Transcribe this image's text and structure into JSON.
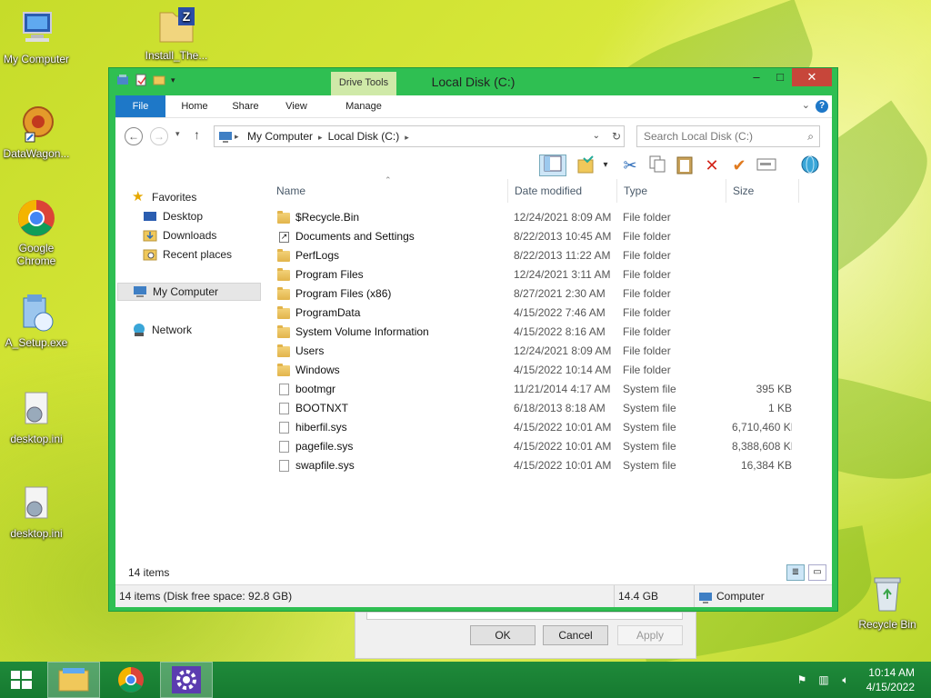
{
  "desktop": {
    "icons": [
      {
        "label": "My Computer"
      },
      {
        "label": "Install_The..."
      },
      {
        "label": "DataWagon..."
      },
      {
        "label": "Google Chrome"
      },
      {
        "label": "A_Setup.exe"
      },
      {
        "label": "desktop.ini"
      },
      {
        "label": "desktop.ini"
      },
      {
        "label": "Recycle Bin"
      }
    ]
  },
  "window": {
    "title": "Local Disk (C:)",
    "context_tab_header": "Drive Tools",
    "tabs": [
      "File",
      "Home",
      "Share",
      "View",
      "Manage"
    ],
    "help_label": "?",
    "address": {
      "crumbs": [
        "My Computer",
        "Local Disk (C:)"
      ]
    },
    "search_placeholder": "Search Local Disk (C:)",
    "navigation": {
      "favorites": "Favorites",
      "favorite_items": [
        "Desktop",
        "Downloads",
        "Recent places"
      ],
      "computer": "My Computer",
      "network": "Network"
    },
    "columns": [
      "Name",
      "Date modified",
      "Type",
      "Size"
    ],
    "files": [
      {
        "name": "$Recycle.Bin",
        "date": "12/24/2021 8:09 AM",
        "type": "File folder",
        "size": "",
        "icon": "folder"
      },
      {
        "name": "Documents and Settings",
        "date": "8/22/2013 10:45 AM",
        "type": "File folder",
        "size": "",
        "icon": "link"
      },
      {
        "name": "PerfLogs",
        "date": "8/22/2013 11:22 AM",
        "type": "File folder",
        "size": "",
        "icon": "folder"
      },
      {
        "name": "Program Files",
        "date": "12/24/2021 3:11 AM",
        "type": "File folder",
        "size": "",
        "icon": "folder"
      },
      {
        "name": "Program Files (x86)",
        "date": "8/27/2021 2:30 AM",
        "type": "File folder",
        "size": "",
        "icon": "folder"
      },
      {
        "name": "ProgramData",
        "date": "4/15/2022 7:46 AM",
        "type": "File folder",
        "size": "",
        "icon": "folder"
      },
      {
        "name": "System Volume Information",
        "date": "4/15/2022 8:16 AM",
        "type": "File folder",
        "size": "",
        "icon": "folder"
      },
      {
        "name": "Users",
        "date": "12/24/2021 8:09 AM",
        "type": "File folder",
        "size": "",
        "icon": "folder"
      },
      {
        "name": "Windows",
        "date": "4/15/2022 10:14 AM",
        "type": "File folder",
        "size": "",
        "icon": "folder"
      },
      {
        "name": "bootmgr",
        "date": "11/21/2014 4:17 AM",
        "type": "System file",
        "size": "395 KB",
        "icon": "file"
      },
      {
        "name": "BOOTNXT",
        "date": "6/18/2013 8:18 AM",
        "type": "System file",
        "size": "1 KB",
        "icon": "file"
      },
      {
        "name": "hiberfil.sys",
        "date": "4/15/2022 10:01 AM",
        "type": "System file",
        "size": "6,710,460 KB",
        "icon": "file"
      },
      {
        "name": "pagefile.sys",
        "date": "4/15/2022 10:01 AM",
        "type": "System file",
        "size": "8,388,608 KB",
        "icon": "file"
      },
      {
        "name": "swapfile.sys",
        "date": "4/15/2022 10:01 AM",
        "type": "System file",
        "size": "16,384 KB",
        "icon": "file"
      }
    ],
    "item_count": "14 items",
    "status": {
      "summary": "14 items (Disk free space: 92.8 GB)",
      "size": "14.4 GB",
      "location": "Computer"
    }
  },
  "dialog": {
    "ok": "OK",
    "cancel": "Cancel",
    "apply": "Apply"
  },
  "taskbar": {
    "time": "10:14 AM",
    "date": "4/15/2022"
  },
  "colors": {
    "window_frame": "#2fbf52",
    "file_tab": "#1e78c8",
    "taskbar": "#1f8a3a",
    "close_button": "#c7463a"
  }
}
